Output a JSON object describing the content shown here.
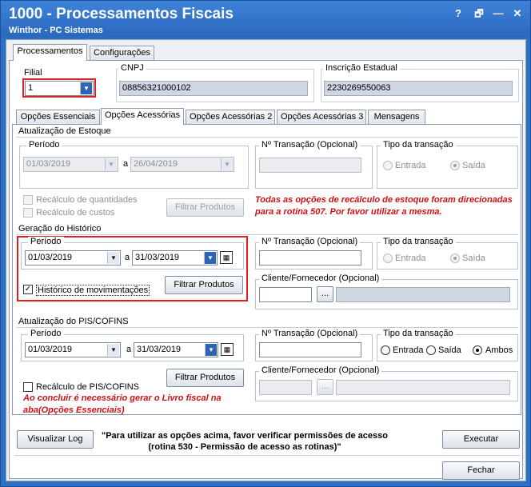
{
  "window": {
    "title": "1000 - Processamentos Fiscais",
    "subtitle": "Winthor - PC Sistemas",
    "buttons": {
      "help": "?",
      "restore": "🗗",
      "minimize": "—",
      "close": "✕"
    }
  },
  "top_tabs": [
    "Processamentos",
    "Configurações"
  ],
  "header": {
    "filial_label": "Filial",
    "filial_value": "1",
    "cnpj_label": "CNPJ",
    "cnpj_value": "08856321000102",
    "ie_label": "Inscrição Estadual",
    "ie_value": "2230269550063"
  },
  "sub_tabs": [
    "Opções Essenciais",
    "Opções Acessórias",
    "Opções Acessórias 2",
    "Opções Acessórias 3",
    "Mensagens"
  ],
  "estoque": {
    "section": "Atualização de Estoque",
    "periodo_label": "Período",
    "date_from": "01/03/2019",
    "a_label": "a",
    "date_to": "26/04/2019",
    "transacao_label": "Nº Transação (Opcional)",
    "tipo_label": "Tipo da transação",
    "entrada": "Entrada",
    "saida": "Saída",
    "recalc_qtd": "Recálculo de quantidades",
    "recalc_custos": "Recálculo de custos",
    "filtrar": "Filtrar Produtos",
    "warning": "Todas as opções de recálculo de estoque foram direcionadas para a rotina 507. Por favor utilizar a mesma."
  },
  "historico": {
    "section": "Geração do Histórico",
    "periodo_label": "Período",
    "date_from": "01/03/2019",
    "a_label": "a",
    "date_to": "31/03/2019",
    "historico_mov": "Histórico de movimentações",
    "filtrar": "Filtrar Produtos",
    "transacao_label": "Nº Transação (Opcional)",
    "tipo_label": "Tipo da transação",
    "entrada": "Entrada",
    "saida": "Saída",
    "cliente_label": "Cliente/Fornecedor (Opcional)",
    "dots": "..."
  },
  "pis": {
    "section": "Atualização do PIS/COFINS",
    "periodo_label": "Período",
    "date_from": "01/03/2019",
    "a_label": "a",
    "date_to": "31/03/2019",
    "transacao_label": "Nº Transação (Opcional)",
    "tipo_label": "Tipo da transação",
    "entrada": "Entrada",
    "saida": "Saída",
    "ambos": "Ambos",
    "recalc_pis": "Recálculo de PIS/COFINS",
    "filtrar": "Filtrar Produtos",
    "cliente_label": "Cliente/Fornecedor (Opcional)",
    "dots": "...",
    "warning": "Ao concluir é necessário gerar o Livro fiscal na aba(Opções Essenciais)"
  },
  "footer": {
    "visualizar_log": "Visualizar Log",
    "message": "\"Para utilizar as opções acima, favor verificar permissões de acesso (rotina 530 - Permissão de acesso as rotinas)\"",
    "executar": "Executar",
    "fechar": "Fechar"
  },
  "colors": {
    "titlebar": "#2d6fc4",
    "highlight": "#e02020",
    "warning_text": "#d01010"
  }
}
